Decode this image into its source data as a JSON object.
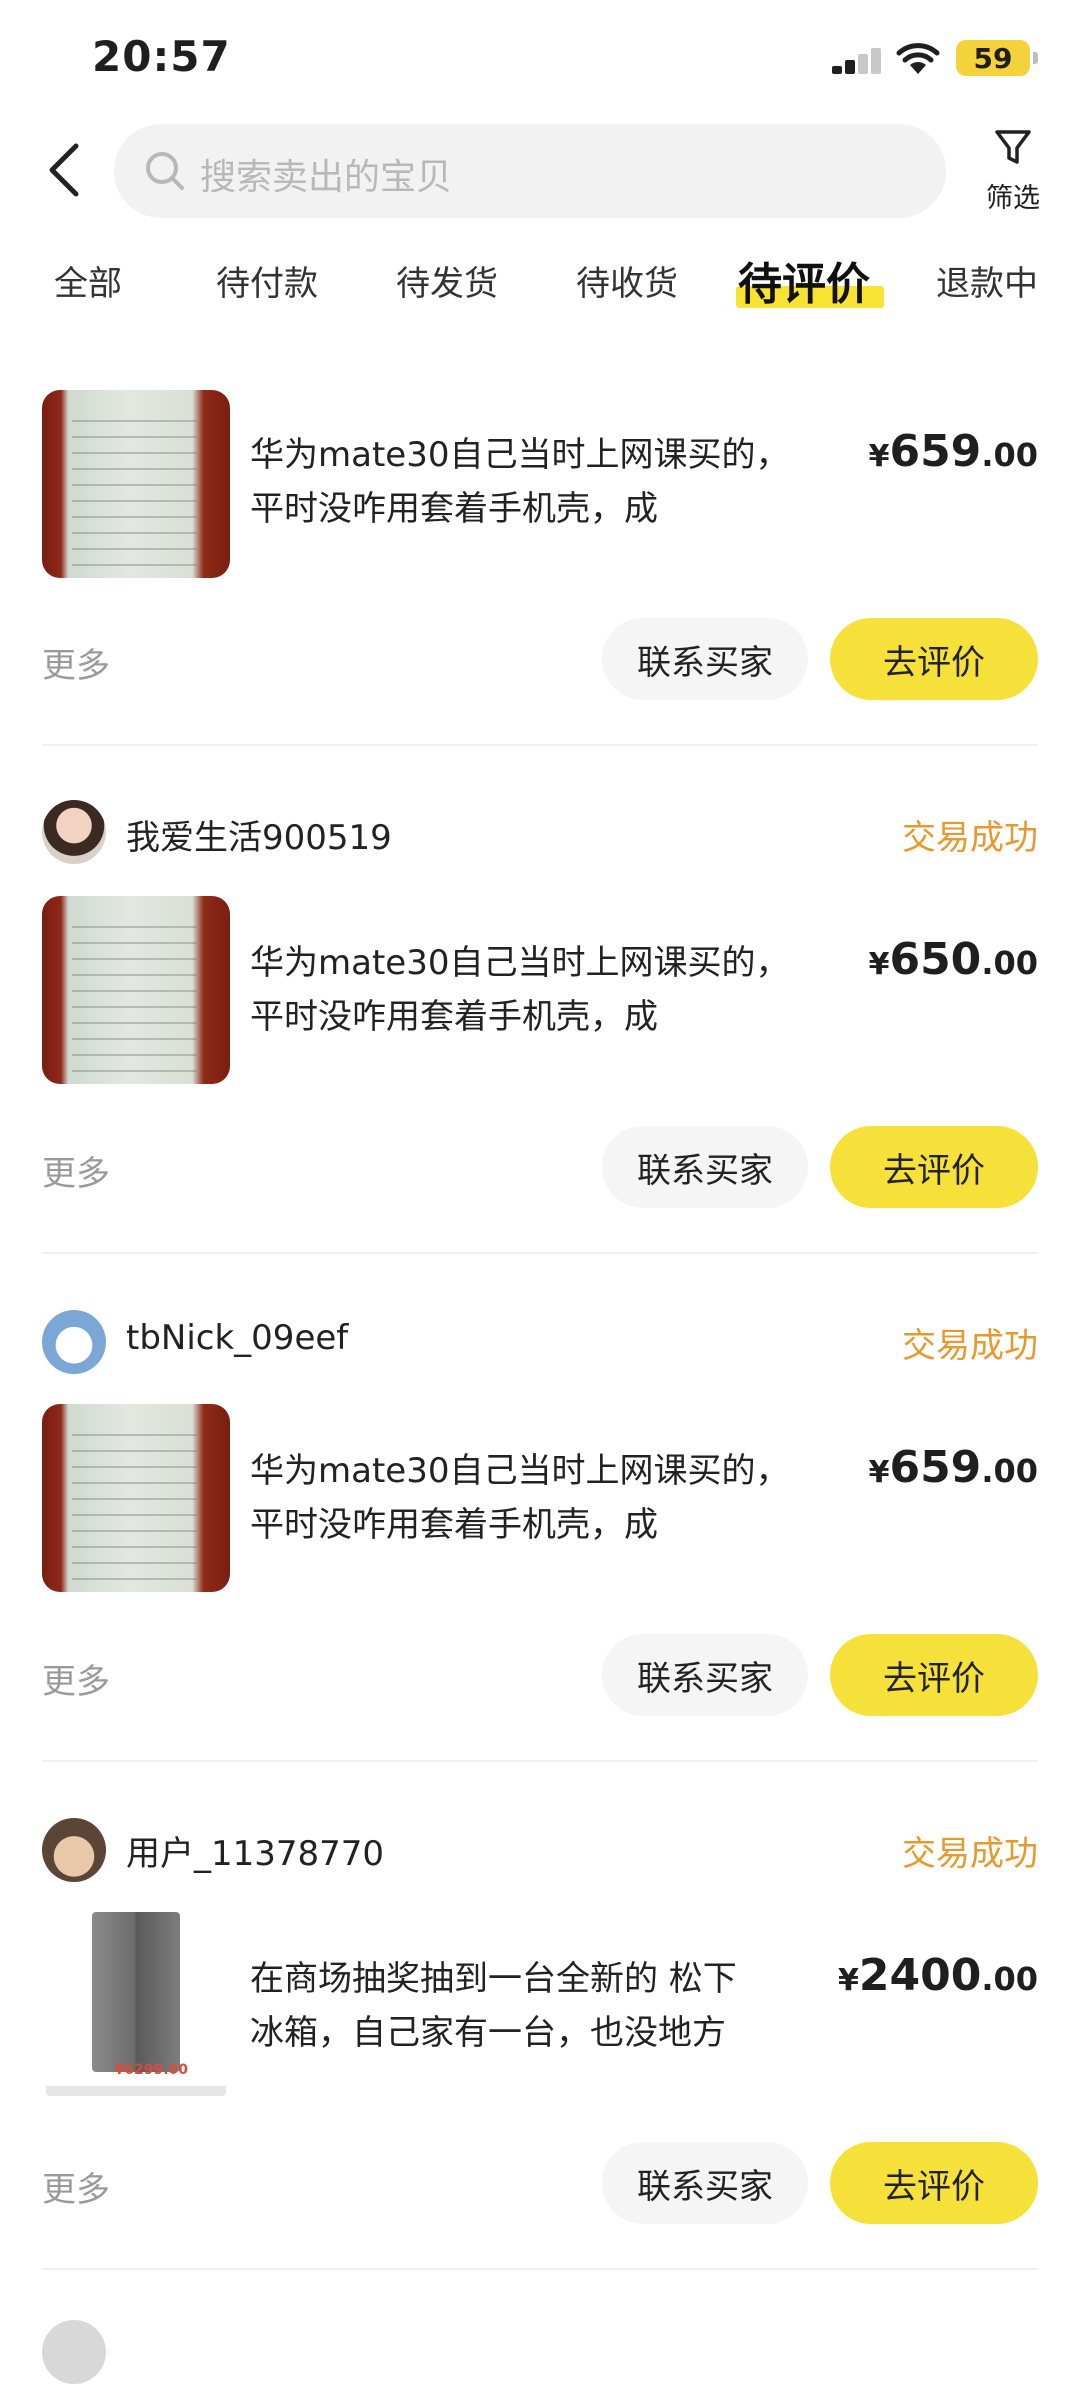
{
  "status_bar": {
    "time": "20:57",
    "battery": "59"
  },
  "search": {
    "placeholder": "搜索卖出的宝贝"
  },
  "filter": {
    "label": "筛选"
  },
  "tabs": [
    {
      "label": "全部"
    },
    {
      "label": "待付款"
    },
    {
      "label": "待发货"
    },
    {
      "label": "待收货"
    },
    {
      "label": "待评价",
      "active": true
    },
    {
      "label": "退款中"
    }
  ],
  "orders": [
    {
      "buyer": "",
      "status": "",
      "title_line1": "华为mate30自己当时上网课买的，",
      "title_line2": "平时没咋用套着手机壳，成",
      "price_int": "659",
      "price_dec": ".00",
      "more": "更多",
      "contact": "联系买家",
      "review": "去评价"
    },
    {
      "buyer": "我爱生活900519",
      "status": "交易成功",
      "title_line1": "华为mate30自己当时上网课买的，",
      "title_line2": "平时没咋用套着手机壳，成",
      "price_int": "650",
      "price_dec": ".00",
      "more": "更多",
      "contact": "联系买家",
      "review": "去评价"
    },
    {
      "buyer": "tbNick_09eef",
      "status": "交易成功",
      "title_line1": "华为mate30自己当时上网课买的，",
      "title_line2": "平时没咋用套着手机壳，成",
      "price_int": "659",
      "price_dec": ".00",
      "more": "更多",
      "contact": "联系买家",
      "review": "去评价"
    },
    {
      "buyer": "用户_11378770",
      "status": "交易成功",
      "title_line1": "在商场抽奖抽到一台全新的 松下",
      "title_line2": "冰箱，自己家有一台，也没地方",
      "price_int": "2400",
      "price_dec": ".00",
      "more": "更多",
      "contact": "联系买家",
      "review": "去评价",
      "thumb_text": "¥6299.00"
    }
  ],
  "currency_symbol": "¥",
  "colors": {
    "accent_yellow": "#f6e13a",
    "status_orange": "#e69a2e"
  }
}
